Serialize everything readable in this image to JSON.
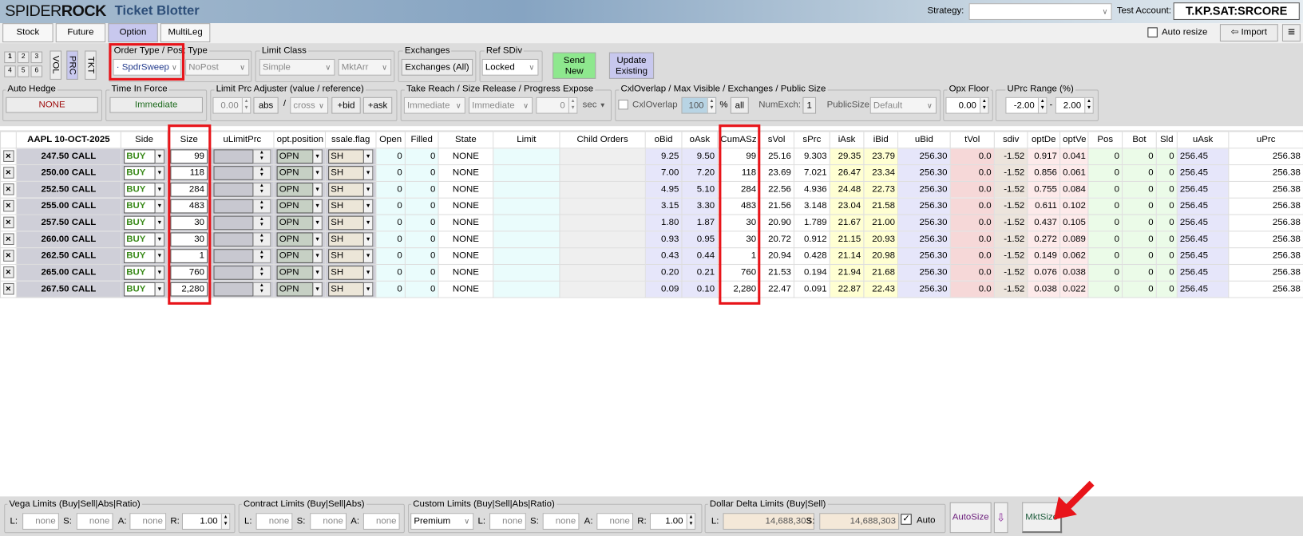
{
  "app": {
    "brand_light": "SPIDER",
    "brand_bold": "ROCK",
    "title": "Ticket Blotter"
  },
  "header": {
    "strategy_label": "Strategy:",
    "strategy_value": "",
    "test_account_label": "Test Account:",
    "test_account_value": "T.KP.SAT:SRCORE"
  },
  "tabs": [
    {
      "label": "Stock"
    },
    {
      "label": "Future"
    },
    {
      "label": "Option",
      "selected": true
    },
    {
      "label": "MultiLeg"
    }
  ],
  "toolbar_right": {
    "auto_resize_label": "Auto resize",
    "auto_resize_checked": false,
    "import_label": "Import",
    "menu_icon": "hamburger-icon"
  },
  "presets": [
    "1",
    "2",
    "3",
    "4",
    "5",
    "6"
  ],
  "modes": [
    "VOL",
    "PRC",
    "TKT"
  ],
  "order_type": {
    "label": "Order Type / Post Type",
    "value": "SpdrSweep",
    "post_value": "NoPost"
  },
  "limit_class": {
    "label": "Limit Class",
    "value": "Simple",
    "value2": "MktArr"
  },
  "exchanges": {
    "label": "Exchanges",
    "button": "Exchanges (All)"
  },
  "ref_sdiv": {
    "label": "Ref SDiv",
    "value": "Locked"
  },
  "send_new": {
    "line1": "Send",
    "line2": "New",
    "color": "#8ee88e"
  },
  "update_existing": {
    "line1": "Update",
    "line2": "Existing",
    "color": "#c8c8ee"
  },
  "auto_hedge": {
    "label": "Auto Hedge",
    "value": "NONE"
  },
  "time_in_force": {
    "label": "Time In Force",
    "value": "Immediate"
  },
  "limit_adj": {
    "label": "Limit Prc Adjuster (value / reference)",
    "value": "0.00",
    "abs": "abs",
    "slash": "/",
    "ref": "cross",
    "bid": "+bid",
    "ask": "+ask"
  },
  "take_reach": {
    "label": "Take Reach / Size Release / Progress Expose",
    "v1": "Immediate",
    "v2": "Immediate",
    "v3": "0",
    "unit": "sec"
  },
  "cxl": {
    "label": "CxlOverlap / Max Visible / Exchanges / Public Size",
    "cxl_label": "CxlOverlap",
    "max_visible": "100",
    "pct": "%",
    "all": "all",
    "numexch_label": "NumExch:",
    "numexch": "1",
    "public_label": "PublicSize:",
    "public_value": "Default"
  },
  "opx_floor": {
    "label": "Opx Floor",
    "value": "0.00"
  },
  "uprc_range": {
    "label": "UPrc Range (%)",
    "low": "-2.00",
    "dash": "-",
    "high": "2.00"
  },
  "table": {
    "columns": [
      "",
      "AAPL 10-OCT-2025",
      "Side",
      "Size",
      "uLimitPrc",
      "opt.position",
      "ssale.flag",
      "Open",
      "Filled",
      "State",
      "Limit",
      "Child Orders",
      "oBid",
      "oAsk",
      "CumASz",
      "sVol",
      "sPrc",
      "iAsk",
      "iBid",
      "uBid",
      "tVol",
      "sdiv",
      "optDe",
      "optVe",
      "Pos",
      "Bot",
      "Sld",
      "uAsk",
      "uPrc"
    ],
    "rows": [
      {
        "name": "247.50 CALL",
        "side": "BUY",
        "size": "99",
        "pos": "OPN",
        "ssale": "SH",
        "open": "0",
        "filled": "0",
        "state": "NONE",
        "limit": "",
        "child": "",
        "obid": "9.25",
        "oask": "9.50",
        "cum": "99",
        "svol": "25.16",
        "sprc": "9.303",
        "iask": "29.35",
        "ibid": "23.79",
        "ubid": "256.30",
        "tvol": "0.0",
        "sdiv": "-1.52",
        "optde": "0.917",
        "optve": "0.041",
        "p": "0",
        "bot": "0",
        "sld": "0",
        "uask": "256.45",
        "uprc": "256.38"
      },
      {
        "name": "250.00 CALL",
        "side": "BUY",
        "size": "118",
        "pos": "OPN",
        "ssale": "SH",
        "open": "0",
        "filled": "0",
        "state": "NONE",
        "limit": "",
        "child": "",
        "obid": "7.00",
        "oask": "7.20",
        "cum": "118",
        "svol": "23.69",
        "sprc": "7.021",
        "iask": "26.47",
        "ibid": "23.34",
        "ubid": "256.30",
        "tvol": "0.0",
        "sdiv": "-1.52",
        "optde": "0.856",
        "optve": "0.061",
        "p": "0",
        "bot": "0",
        "sld": "0",
        "uask": "256.45",
        "uprc": "256.38"
      },
      {
        "name": "252.50 CALL",
        "side": "BUY",
        "size": "284",
        "pos": "OPN",
        "ssale": "SH",
        "open": "0",
        "filled": "0",
        "state": "NONE",
        "limit": "",
        "child": "",
        "obid": "4.95",
        "oask": "5.10",
        "cum": "284",
        "svol": "22.56",
        "sprc": "4.936",
        "iask": "24.48",
        "ibid": "22.73",
        "ubid": "256.30",
        "tvol": "0.0",
        "sdiv": "-1.52",
        "optde": "0.755",
        "optve": "0.084",
        "p": "0",
        "bot": "0",
        "sld": "0",
        "uask": "256.45",
        "uprc": "256.38"
      },
      {
        "name": "255.00 CALL",
        "side": "BUY",
        "size": "483",
        "pos": "OPN",
        "ssale": "SH",
        "open": "0",
        "filled": "0",
        "state": "NONE",
        "limit": "",
        "child": "",
        "obid": "3.15",
        "oask": "3.30",
        "cum": "483",
        "svol": "21.56",
        "sprc": "3.148",
        "iask": "23.04",
        "ibid": "21.58",
        "ubid": "256.30",
        "tvol": "0.0",
        "sdiv": "-1.52",
        "optde": "0.611",
        "optve": "0.102",
        "p": "0",
        "bot": "0",
        "sld": "0",
        "uask": "256.45",
        "uprc": "256.38"
      },
      {
        "name": "257.50 CALL",
        "side": "BUY",
        "size": "30",
        "pos": "OPN",
        "ssale": "SH",
        "open": "0",
        "filled": "0",
        "state": "NONE",
        "limit": "",
        "child": "",
        "obid": "1.80",
        "oask": "1.87",
        "cum": "30",
        "svol": "20.90",
        "sprc": "1.789",
        "iask": "21.67",
        "ibid": "21.00",
        "ubid": "256.30",
        "tvol": "0.0",
        "sdiv": "-1.52",
        "optde": "0.437",
        "optve": "0.105",
        "p": "0",
        "bot": "0",
        "sld": "0",
        "uask": "256.45",
        "uprc": "256.38"
      },
      {
        "name": "260.00 CALL",
        "side": "BUY",
        "size": "30",
        "pos": "OPN",
        "ssale": "SH",
        "open": "0",
        "filled": "0",
        "state": "NONE",
        "limit": "",
        "child": "",
        "obid": "0.93",
        "oask": "0.95",
        "cum": "30",
        "svol": "20.72",
        "sprc": "0.912",
        "iask": "21.15",
        "ibid": "20.93",
        "ubid": "256.30",
        "tvol": "0.0",
        "sdiv": "-1.52",
        "optde": "0.272",
        "optve": "0.089",
        "p": "0",
        "bot": "0",
        "sld": "0",
        "uask": "256.45",
        "uprc": "256.38"
      },
      {
        "name": "262.50 CALL",
        "side": "BUY",
        "size": "1",
        "pos": "OPN",
        "ssale": "SH",
        "open": "0",
        "filled": "0",
        "state": "NONE",
        "limit": "",
        "child": "",
        "obid": "0.43",
        "oask": "0.44",
        "cum": "1",
        "svol": "20.94",
        "sprc": "0.428",
        "iask": "21.14",
        "ibid": "20.98",
        "ubid": "256.30",
        "tvol": "0.0",
        "sdiv": "-1.52",
        "optde": "0.149",
        "optve": "0.062",
        "p": "0",
        "bot": "0",
        "sld": "0",
        "uask": "256.45",
        "uprc": "256.38"
      },
      {
        "name": "265.00 CALL",
        "side": "BUY",
        "size": "760",
        "pos": "OPN",
        "ssale": "SH",
        "open": "0",
        "filled": "0",
        "state": "NONE",
        "limit": "",
        "child": "",
        "obid": "0.20",
        "oask": "0.21",
        "cum": "760",
        "svol": "21.53",
        "sprc": "0.194",
        "iask": "21.94",
        "ibid": "21.68",
        "ubid": "256.30",
        "tvol": "0.0",
        "sdiv": "-1.52",
        "optde": "0.076",
        "optve": "0.038",
        "p": "0",
        "bot": "0",
        "sld": "0",
        "uask": "256.45",
        "uprc": "256.38"
      },
      {
        "name": "267.50 CALL",
        "side": "BUY",
        "size": "2,280",
        "pos": "OPN",
        "ssale": "SH",
        "open": "0",
        "filled": "0",
        "state": "NONE",
        "limit": "",
        "child": "",
        "obid": "0.09",
        "oask": "0.10",
        "cum": "2,280",
        "svol": "22.47",
        "sprc": "0.091",
        "iask": "22.87",
        "ibid": "22.43",
        "ubid": "256.30",
        "tvol": "0.0",
        "sdiv": "-1.52",
        "optde": "0.038",
        "optve": "0.022",
        "p": "0",
        "bot": "0",
        "sld": "0",
        "uask": "256.45",
        "uprc": "256.38"
      }
    ]
  },
  "bottom": {
    "vega": {
      "label": "Vega Limits (Buy|Sell|Abs|Ratio)",
      "l": "L:",
      "s": "S:",
      "a": "A:",
      "r": "R:",
      "lv": "none",
      "sv": "none",
      "av": "none",
      "rv": "1.00"
    },
    "contract": {
      "label": "Contract Limits (Buy|Sell|Abs)",
      "l": "L:",
      "s": "S:",
      "a": "A:",
      "lv": "none",
      "sv": "none",
      "av": "none"
    },
    "custom": {
      "label": "Custom Limits (Buy|Sell|Abs|Ratio)",
      "type": "Premium",
      "l": "L:",
      "s": "S:",
      "a": "A:",
      "r": "R:",
      "lv": "none",
      "sv": "none",
      "av": "none",
      "rv": "1.00"
    },
    "dollar_delta": {
      "label": "Dollar Delta Limits (Buy|Sell)",
      "l": "L:",
      "s": "S:",
      "lv": "14,688,303",
      "sv": "14,688,303",
      "auto_label": "Auto",
      "auto_checked": true
    },
    "autosize": "AutoSize",
    "mktsize": "MktSize"
  },
  "annotation_color": "#e8141a"
}
